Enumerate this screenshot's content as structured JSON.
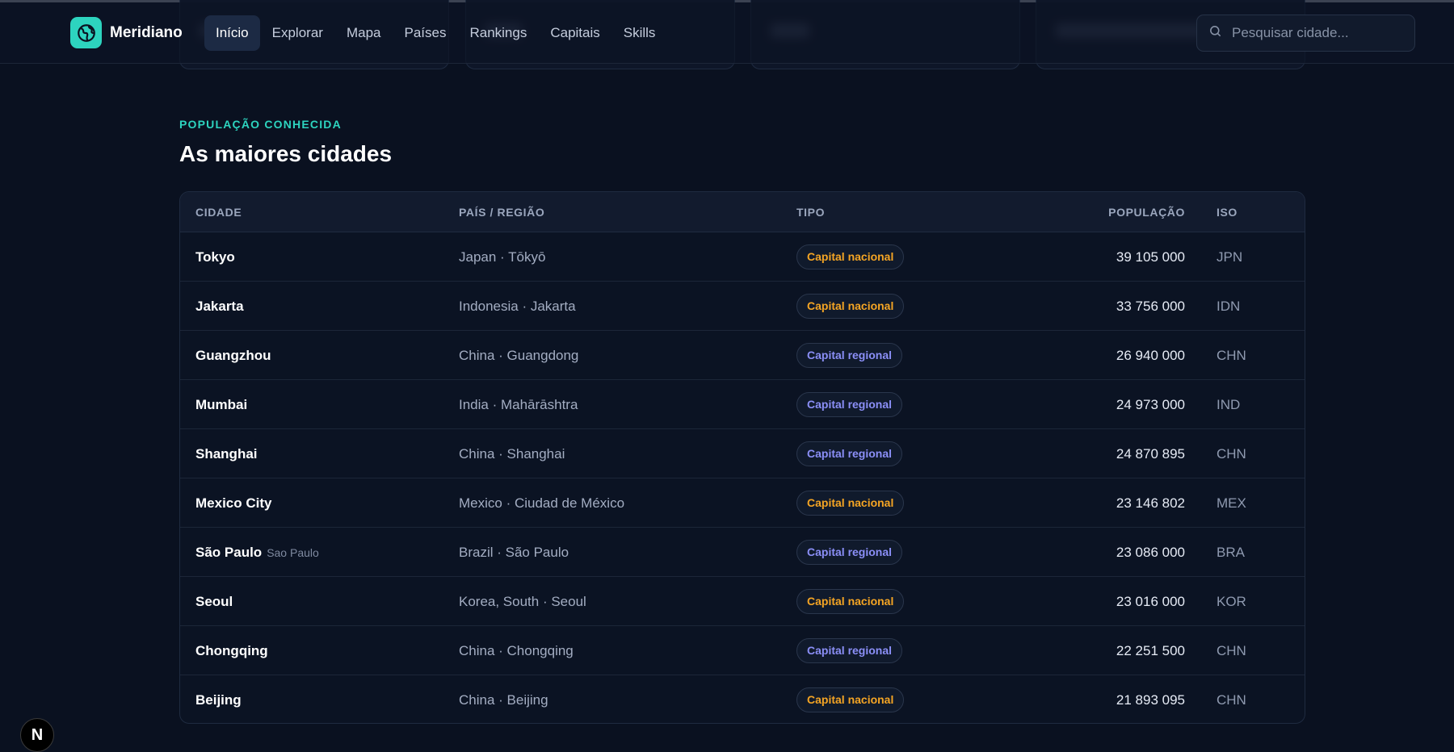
{
  "header": {
    "brand": "Meridiano",
    "nav": [
      "Início",
      "Explorar",
      "Mapa",
      "Países",
      "Rankings",
      "Capitais",
      "Skills"
    ],
    "active_nav": "Início",
    "search_placeholder": "Pesquisar cidade..."
  },
  "section": {
    "eyebrow": "POPULAÇÃO CONHECIDA",
    "title": "As maiores cidades"
  },
  "table": {
    "columns": {
      "city": "CIDADE",
      "country": "PAÍS / REGIÃO",
      "type": "TIPO",
      "population": "POPULAÇÃO",
      "iso": "ISO"
    },
    "type_colors": {
      "Capital nacional": "#f5a524",
      "Capital regional": "#8b8ff7"
    },
    "rows": [
      {
        "city": "Tokyo",
        "alt": "",
        "country": "Japan · Tōkyō",
        "type": "Capital nacional",
        "population": "39 105 000",
        "iso": "JPN"
      },
      {
        "city": "Jakarta",
        "alt": "",
        "country": "Indonesia · Jakarta",
        "type": "Capital nacional",
        "population": "33 756 000",
        "iso": "IDN"
      },
      {
        "city": "Guangzhou",
        "alt": "",
        "country": "China · Guangdong",
        "type": "Capital regional",
        "population": "26 940 000",
        "iso": "CHN"
      },
      {
        "city": "Mumbai",
        "alt": "",
        "country": "India · Mahārāshtra",
        "type": "Capital regional",
        "population": "24 973 000",
        "iso": "IND"
      },
      {
        "city": "Shanghai",
        "alt": "",
        "country": "China · Shanghai",
        "type": "Capital regional",
        "population": "24 870 895",
        "iso": "CHN"
      },
      {
        "city": "Mexico City",
        "alt": "",
        "country": "Mexico · Ciudad de México",
        "type": "Capital nacional",
        "population": "23 146 802",
        "iso": "MEX"
      },
      {
        "city": "São Paulo",
        "alt": "Sao Paulo",
        "country": "Brazil · São Paulo",
        "type": "Capital regional",
        "population": "23 086 000",
        "iso": "BRA"
      },
      {
        "city": "Seoul",
        "alt": "",
        "country": "Korea, South · Seoul",
        "type": "Capital nacional",
        "population": "23 016 000",
        "iso": "KOR"
      },
      {
        "city": "Chongqing",
        "alt": "",
        "country": "China · Chongqing",
        "type": "Capital regional",
        "population": "22 251 500",
        "iso": "CHN"
      },
      {
        "city": "Beijing",
        "alt": "",
        "country": "China · Beijing",
        "type": "Capital nacional",
        "population": "21 893 095",
        "iso": "CHN"
      }
    ]
  },
  "framework_badge": "N"
}
